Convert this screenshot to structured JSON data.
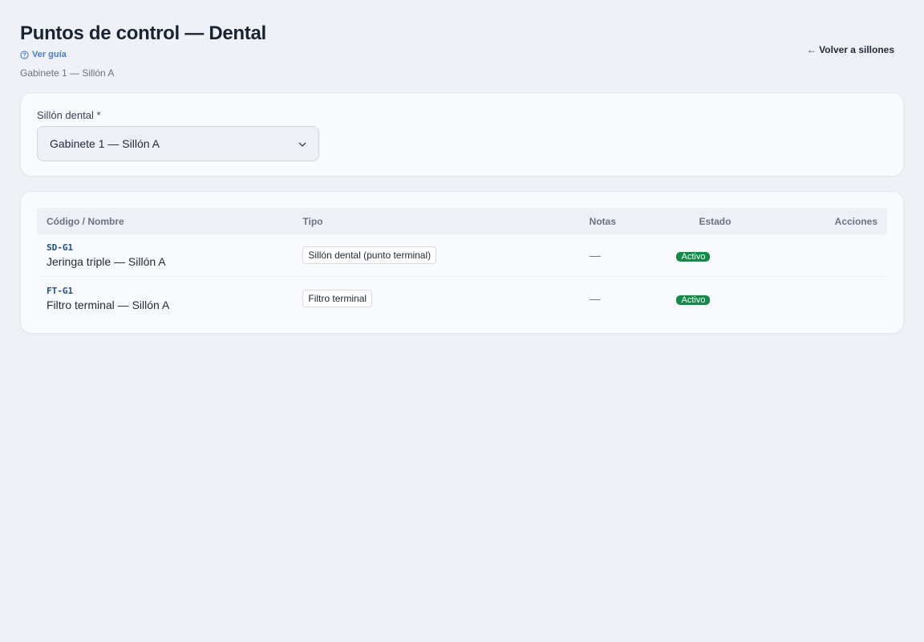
{
  "header": {
    "title": "Puntos de control — Dental",
    "guide_link": "Ver guía",
    "subtitle": "Gabinete 1 — Sillón A",
    "back_link": "← Volver a sillones"
  },
  "selector": {
    "label": "Sillón dental *",
    "value": "Gabinete 1 — Sillón A"
  },
  "table": {
    "columns": [
      "Código / Nombre",
      "Tipo",
      "Notas",
      "Estado",
      "Acciones"
    ],
    "rows": [
      {
        "code": "SD-G1",
        "name": "Jeringa triple — Sillón A",
        "tipo": "Sillón dental (punto terminal)",
        "notas": "—",
        "estado": "Activo"
      },
      {
        "code": "FT-G1",
        "name": "Filtro terminal — Sillón A",
        "tipo": "Filtro terminal",
        "notas": "—",
        "estado": "Activo"
      }
    ]
  },
  "colors": {
    "accent_link": "#4a7dc4",
    "status_active": "#148a48",
    "background": "#eef2f7"
  },
  "icons": {
    "guide": "help-circle-icon",
    "select": "chevron-down-icon"
  }
}
